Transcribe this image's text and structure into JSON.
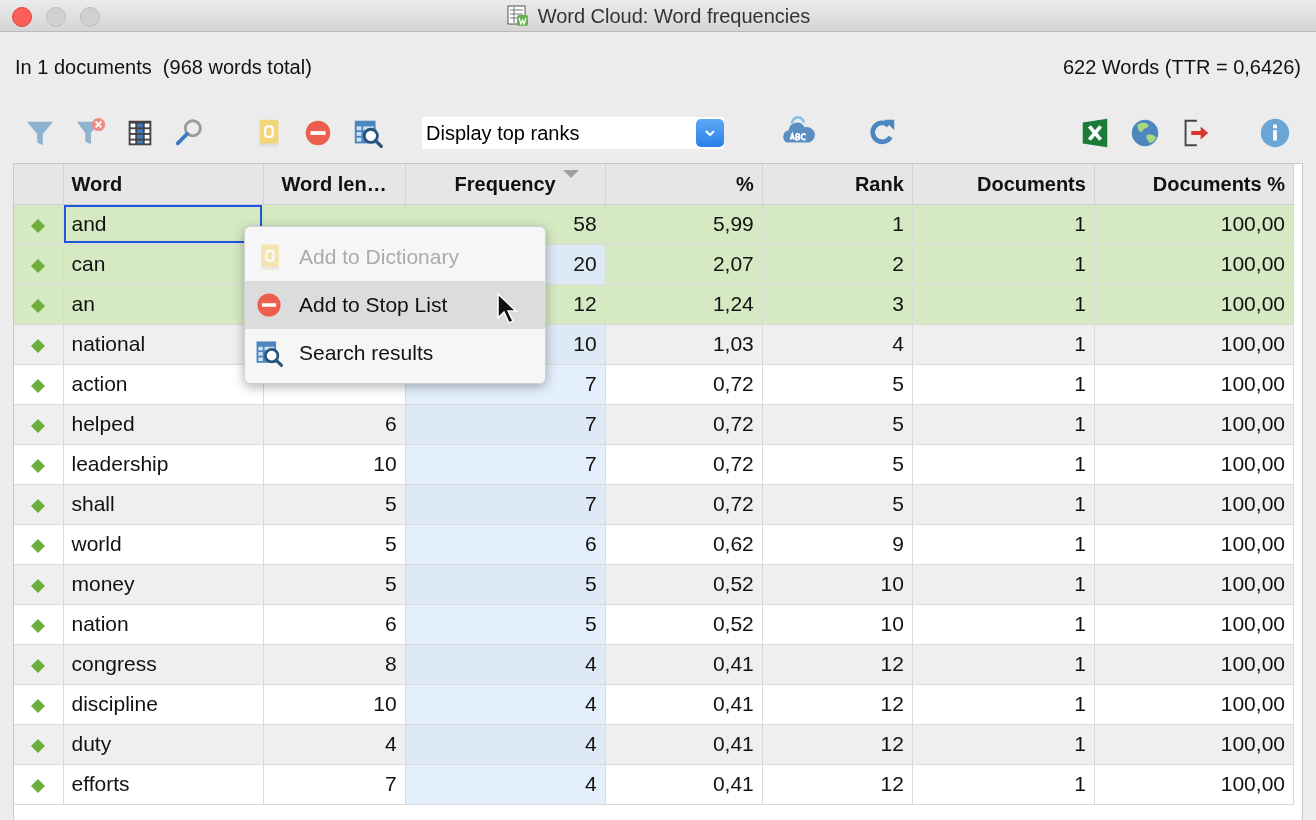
{
  "window": {
    "title": "Word Cloud: Word frequencies"
  },
  "summary": {
    "left": "In 1 documents  (968 words total)",
    "right": "622 Words (TTR = 0,6426)"
  },
  "toolbar": {
    "groups": [
      [
        {
          "kind": "filter"
        },
        {
          "kind": "filter-clear"
        },
        {
          "kind": "grid"
        },
        {
          "kind": "magnifier"
        }
      ],
      [
        {
          "kind": "dictionary"
        },
        {
          "kind": "stop"
        },
        {
          "kind": "search-results"
        }
      ],
      [
        {
          "kind": "dropdown",
          "value": "Display top ranks"
        }
      ],
      [
        {
          "kind": "cloud"
        }
      ],
      [
        {
          "kind": "refresh"
        }
      ],
      [
        {
          "kind": "spreadsheet"
        },
        {
          "kind": "globe"
        },
        {
          "kind": "export"
        }
      ],
      [
        {
          "kind": "info"
        }
      ]
    ]
  },
  "table": {
    "columns": [
      {
        "label": "Word",
        "sorted": false
      },
      {
        "label": "Word len…",
        "sorted": false
      },
      {
        "label": "Frequency",
        "sorted": true
      },
      {
        "label": "%",
        "sorted": false
      },
      {
        "label": "Rank",
        "sorted": false
      },
      {
        "label": "Documents",
        "sorted": false
      },
      {
        "label": "Documents %",
        "sorted": false
      }
    ],
    "rows": [
      {
        "selected": true,
        "focused": true,
        "cells": [
          "and",
          null,
          "58",
          "5,99",
          "1",
          "1",
          "100,00"
        ]
      },
      {
        "selected": true,
        "focused": false,
        "cells": [
          "can",
          null,
          "20",
          "2,07",
          "2",
          "1",
          "100,00"
        ]
      },
      {
        "selected": true,
        "focused": false,
        "cells": [
          "an",
          null,
          "12",
          "1,24",
          "3",
          "1",
          "100,00"
        ]
      },
      {
        "selected": false,
        "focused": false,
        "cells": [
          "national",
          null,
          "10",
          "1,03",
          "4",
          "1",
          "100,00"
        ]
      },
      {
        "selected": false,
        "focused": false,
        "cells": [
          "action",
          null,
          "7",
          "0,72",
          "5",
          "1",
          "100,00"
        ]
      },
      {
        "selected": false,
        "focused": false,
        "cells": [
          "helped",
          "6",
          "7",
          "0,72",
          "5",
          "1",
          "100,00"
        ]
      },
      {
        "selected": false,
        "focused": false,
        "cells": [
          "leadership",
          "10",
          "7",
          "0,72",
          "5",
          "1",
          "100,00"
        ]
      },
      {
        "selected": false,
        "focused": false,
        "cells": [
          "shall",
          "5",
          "7",
          "0,72",
          "5",
          "1",
          "100,00"
        ]
      },
      {
        "selected": false,
        "focused": false,
        "cells": [
          "world",
          "5",
          "6",
          "0,62",
          "9",
          "1",
          "100,00"
        ]
      },
      {
        "selected": false,
        "focused": false,
        "cells": [
          "money",
          "5",
          "5",
          "0,52",
          "10",
          "1",
          "100,00"
        ]
      },
      {
        "selected": false,
        "focused": false,
        "cells": [
          "nation",
          "6",
          "5",
          "0,52",
          "10",
          "1",
          "100,00"
        ]
      },
      {
        "selected": false,
        "focused": false,
        "cells": [
          "congress",
          "8",
          "4",
          "0,41",
          "12",
          "1",
          "100,00"
        ]
      },
      {
        "selected": false,
        "focused": false,
        "cells": [
          "discipline",
          "10",
          "4",
          "0,41",
          "12",
          "1",
          "100,00"
        ]
      },
      {
        "selected": false,
        "focused": false,
        "cells": [
          "duty",
          "4",
          "4",
          "0,41",
          "12",
          "1",
          "100,00"
        ]
      },
      {
        "selected": false,
        "focused": false,
        "cells": [
          "efforts",
          "7",
          "4",
          "0,41",
          "12",
          "1",
          "100,00"
        ]
      }
    ]
  },
  "context_menu": {
    "items": [
      {
        "kind": "dictionary",
        "label": "Add to Dictionary",
        "disabled": true,
        "highlighted": false
      },
      {
        "kind": "stop",
        "label": "Add to Stop List",
        "disabled": false,
        "highlighted": true
      },
      {
        "kind": "search-results",
        "label": "Search results",
        "disabled": false,
        "highlighted": false
      }
    ]
  }
}
